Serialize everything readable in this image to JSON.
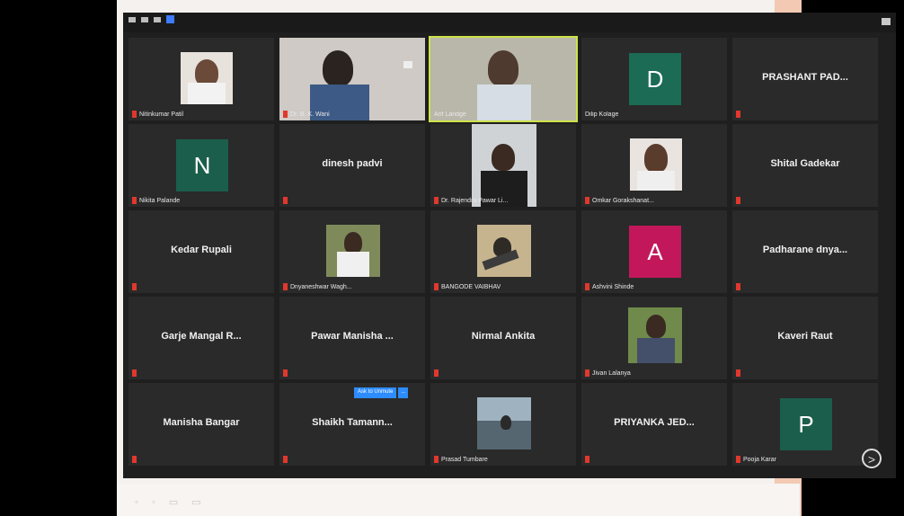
{
  "window": {
    "view_icons": [
      "minimize-icon",
      "restore-icon",
      "speaker-view-icon",
      "gallery-view-icon"
    ]
  },
  "tiles": [
    {
      "label": "Nitinkumar Patil",
      "kind": "photo"
    },
    {
      "label": "Dr. B. K. Wani",
      "kind": "video"
    },
    {
      "label": "Arif Landge",
      "kind": "video"
    },
    {
      "label": "Dilip Kolage",
      "kind": "letter",
      "letter": "D",
      "color": "#1b5e4b"
    },
    {
      "label": "",
      "kind": "name",
      "name": "PRASHANT PAD..."
    },
    {
      "label": "Nikita Palande",
      "kind": "letter",
      "letter": "N",
      "color": "#1b5e4b"
    },
    {
      "label": "",
      "kind": "name",
      "name": "dinesh padvi"
    },
    {
      "label": "Dr. Rajendra Pawar Li...",
      "kind": "video"
    },
    {
      "label": "Omkar Gorakshanat...",
      "kind": "photo"
    },
    {
      "label": "",
      "kind": "name",
      "name": "Shital Gadekar"
    },
    {
      "label": "",
      "kind": "name",
      "name": "Kedar Rupali"
    },
    {
      "label": "Dnyaneshwar Wagh...",
      "kind": "photo"
    },
    {
      "label": "BANGODE VAIBHAV",
      "kind": "photo"
    },
    {
      "label": "Ashvini Shinde",
      "kind": "letter",
      "letter": "A",
      "color": "#c2185b"
    },
    {
      "label": "",
      "kind": "name",
      "name": "Padharane dnya..."
    },
    {
      "label": "",
      "kind": "name",
      "name": "Garje Mangal R..."
    },
    {
      "label": "",
      "kind": "name",
      "name": "Pawar Manisha ..."
    },
    {
      "label": "",
      "kind": "name",
      "name": "Nirmal Ankita"
    },
    {
      "label": "Jivan Lalanya",
      "kind": "photo"
    },
    {
      "label": "",
      "kind": "name",
      "name": "Kaveri Raut"
    },
    {
      "label": "",
      "kind": "name",
      "name": "Manisha Bangar"
    },
    {
      "label": "",
      "kind": "name",
      "name": "Shaikh Tamann..."
    },
    {
      "label": "Prasad Tumbare",
      "kind": "photo"
    },
    {
      "label": "",
      "kind": "name",
      "name": "PRIYANKA JED..."
    },
    {
      "label": "Pooja Karar",
      "kind": "letter",
      "letter": "P",
      "color": "#1b5e4b"
    }
  ],
  "ask_to_unmute": {
    "label": "Ask to Unmute",
    "more": "..."
  },
  "next_page": ">"
}
